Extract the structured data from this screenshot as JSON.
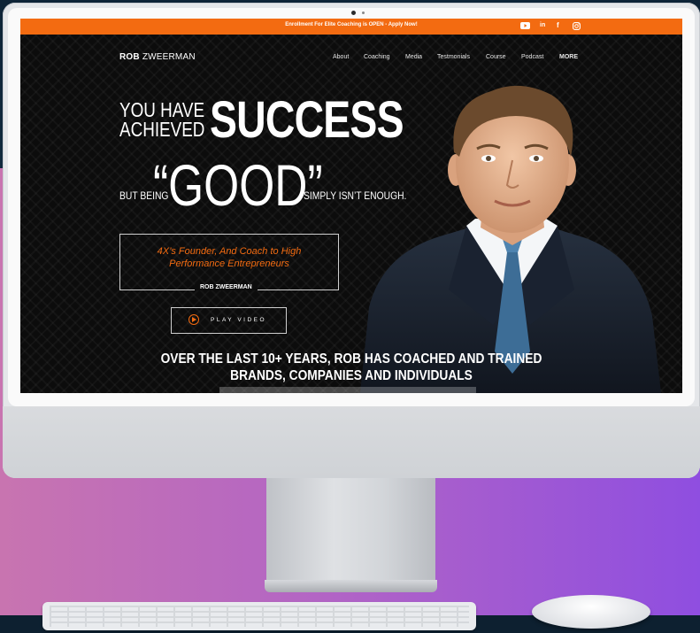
{
  "announcement": "Enrollment For Elite Coaching is OPEN - Apply Now!",
  "social": {
    "youtube": "youtube-icon",
    "linkedin": "in",
    "facebook": "f",
    "instagram": "instagram-icon"
  },
  "brand": {
    "first": "ROB",
    "last": "ZWEERMAN"
  },
  "nav": [
    "About",
    "Coaching",
    "Media",
    "Testmonials",
    "Course",
    "Podcast",
    "MORE"
  ],
  "hero": {
    "line1": "YOU HAVE",
    "line2": "ACHIEVED",
    "big": "SUCCESS",
    "but_being": "BUT BEING",
    "good": "“GOOD”",
    "tail": "SIMPLY ISN’T ENOUGH."
  },
  "quote": {
    "line1": "4X’s Founder, And Coach to High",
    "line2": "Performance Entrepreneurs",
    "author": "ROB ZWEERMAN"
  },
  "play_button": "PLAY VIDEO",
  "bottom_heading": {
    "line1": "OVER THE LAST 10+ YEARS, ROB HAS COACHED AND TRAINED",
    "line2": "BRANDS, COMPANIES AND INDIVIDUALS"
  },
  "colors": {
    "accent": "#f36b11",
    "screen_bg": "#0c0c0c"
  }
}
